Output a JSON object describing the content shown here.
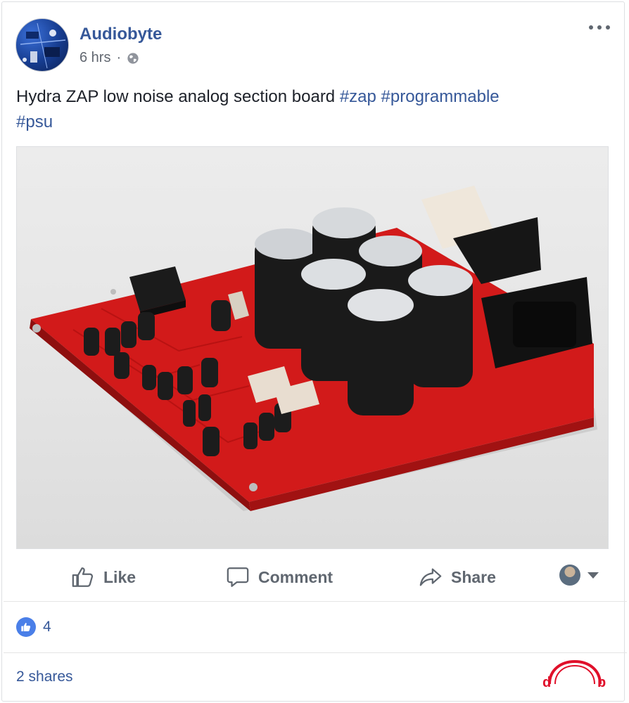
{
  "post": {
    "author": "Audiobyte",
    "time": "6 hrs",
    "separator": "·",
    "text_plain": "Hydra ZAP low noise analog section board ",
    "hashtags": [
      "#zap",
      "#programmable",
      "#psu"
    ],
    "privacy_icon": "globe-icon",
    "more_icon": "more-options-icon"
  },
  "actions": {
    "like": "Like",
    "comment": "Comment",
    "share": "Share"
  },
  "reactions": {
    "count": "4",
    "icon": "thumbs-up-icon",
    "color": "#4a7fe8"
  },
  "shares": {
    "label": "2 shares"
  },
  "colors": {
    "link": "#365899",
    "board_red": "#d01818",
    "logo_red": "#e0102a"
  }
}
